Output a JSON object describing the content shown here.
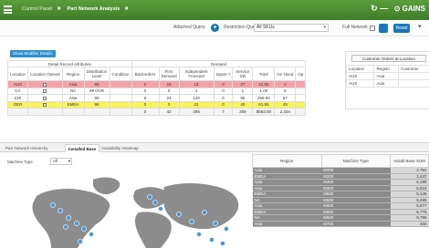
{
  "topbar": {
    "tabs": [
      {
        "label": "Control Panel",
        "active": false
      },
      {
        "label": "Part Network Analysis",
        "active": true
      }
    ],
    "right_icon": "rotate-icon",
    "dash": "—",
    "brand": "⊙ GAINS"
  },
  "filters": {
    "attached_label": "Attached Query",
    "restriction_label": "Restriction Query",
    "restriction_value": "All SKUs",
    "full_network_label": "Full Network",
    "reset_label": "Reset"
  },
  "details_button": "Show Modifier Details",
  "main_table": {
    "group_headers": [
      "Detail Record Attributes",
      "Demand"
    ],
    "columns": [
      "Location",
      "Location Owned",
      "Region",
      "Distribution Level",
      "Condition",
      "Backorders",
      "Firm Demand",
      "Independent Forecast",
      "Spare ?",
      "Service Stk",
      "Total",
      "On Hand",
      "Op"
    ],
    "rows": [
      {
        "style": "red",
        "cells": [
          "AUS",
          "",
          "Asia",
          "99",
          "",
          "0",
          "18",
          "14",
          "0",
          "27",
          "41.55",
          "2",
          ""
        ]
      },
      {
        "style": "white",
        "cells": [
          "CA",
          "",
          "NA",
          "99 OVR",
          "",
          "0",
          "0",
          "1",
          "0",
          "1",
          "1.00",
          "5",
          ""
        ]
      },
      {
        "style": "white",
        "cells": [
          "CHI",
          "",
          "Asia",
          "99",
          "",
          "0",
          "24",
          "120",
          "0",
          "95",
          "259.00",
          "57",
          ""
        ]
      },
      {
        "style": "yellow",
        "cells": [
          "GER",
          "",
          "EMEA",
          "99",
          "",
          "0",
          "0",
          "21",
          "0",
          "40",
          "61.55",
          "45",
          ""
        ]
      },
      {
        "style": "grey",
        "cells": [
          "",
          "",
          "",
          "",
          "",
          "0",
          "42",
          "286",
          "7",
          "299",
          "$583.00",
          "2,434",
          ""
        ]
      }
    ]
  },
  "customer_orders": {
    "button_label": "Customer Orders at Location",
    "columns": [
      "Location",
      "Region",
      "Customer"
    ],
    "rows": [
      [
        "AUS",
        "Asia",
        ""
      ],
      [
        "AUS",
        "Asia",
        ""
      ]
    ]
  },
  "bottom_tabs": [
    {
      "label": "Part Network Hierarchy",
      "active": false
    },
    {
      "label": "Installed Base",
      "active": true
    },
    {
      "label": "Availability Heatmap",
      "active": false
    }
  ],
  "machine_type": {
    "label": "Machine Type",
    "value": "All"
  },
  "installed_base": {
    "columns": [
      "Region",
      "Machine Type",
      "Install Base SUM"
    ],
    "rows": [
      [
        "Asia",
        "M200",
        "2,752"
      ],
      [
        "EMEA",
        "M200",
        "2,447"
      ],
      [
        "Asia",
        "M300",
        "5,195"
      ],
      [
        "Asia",
        "M300",
        "5,816"
      ],
      [
        "EMEA",
        "M500",
        "5,146"
      ],
      [
        "NA",
        "M500",
        "9,495"
      ],
      [
        "Asia",
        "M500",
        "5,677"
      ],
      [
        "EMEA",
        "M600",
        "6,775"
      ],
      [
        "NA",
        "M600",
        "9,796"
      ],
      [
        "Asia",
        "M700",
        "455"
      ]
    ]
  },
  "colors": {
    "brand_green": "#4a8f33",
    "accent_blue": "#1976b8",
    "row_red": "#f3a3a8",
    "row_yellow": "#f7f35a",
    "map_land": "#8c8c8c",
    "map_dot": "#4f97d5"
  }
}
